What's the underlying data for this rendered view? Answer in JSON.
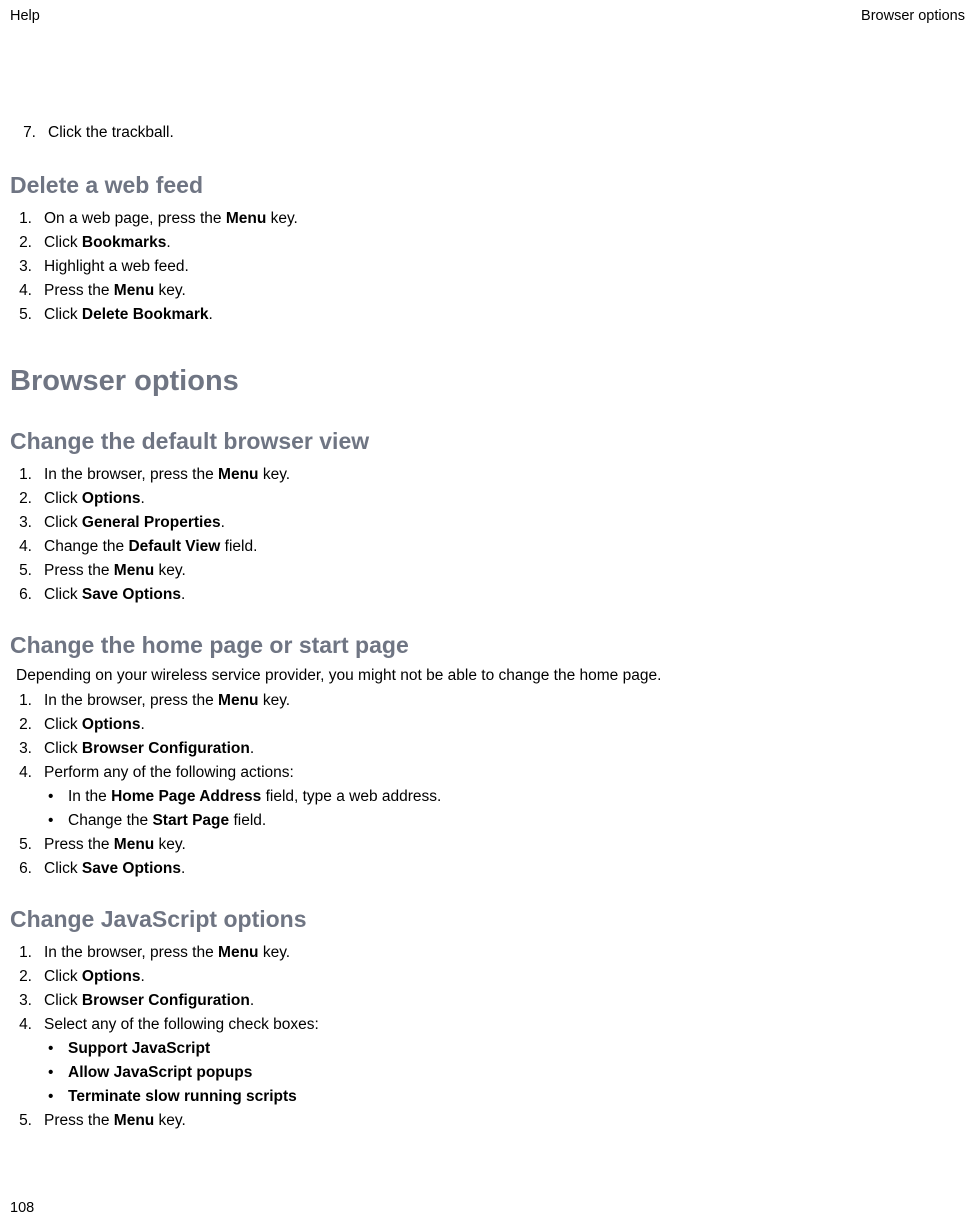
{
  "header": {
    "left": "Help",
    "right": "Browser options"
  },
  "step7": {
    "num": "7.",
    "text": "Click the trackball."
  },
  "sections": {
    "delete_feed": {
      "title": "Delete a web feed",
      "steps": [
        {
          "num": "1.",
          "pre": "On a web page, press the ",
          "bold": "Menu",
          "post": " key."
        },
        {
          "num": "2.",
          "pre": "Click ",
          "bold": "Bookmarks",
          "post": "."
        },
        {
          "num": "3.",
          "pre": "Highlight a web feed.",
          "bold": "",
          "post": ""
        },
        {
          "num": "4.",
          "pre": "Press the ",
          "bold": "Menu",
          "post": " key."
        },
        {
          "num": "5.",
          "pre": "Click ",
          "bold": "Delete Bookmark",
          "post": "."
        }
      ]
    },
    "browser_options": {
      "title": "Browser options"
    },
    "default_view": {
      "title": "Change the default browser view",
      "steps": [
        {
          "num": "1.",
          "pre": "In the browser, press the ",
          "bold": "Menu",
          "post": " key."
        },
        {
          "num": "2.",
          "pre": "Click ",
          "bold": "Options",
          "post": "."
        },
        {
          "num": "3.",
          "pre": "Click ",
          "bold": "General Properties",
          "post": "."
        },
        {
          "num": "4.",
          "pre": "Change the ",
          "bold": "Default View",
          "post": " field."
        },
        {
          "num": "5.",
          "pre": "Press the ",
          "bold": "Menu",
          "post": " key."
        },
        {
          "num": "6.",
          "pre": "Click ",
          "bold": "Save Options",
          "post": "."
        }
      ]
    },
    "home_page": {
      "title": "Change the home page or start page",
      "intro": "Depending on your wireless service provider, you might not be able to change the home page.",
      "steps": [
        {
          "num": "1.",
          "pre": "In the browser, press the ",
          "bold": "Menu",
          "post": " key."
        },
        {
          "num": "2.",
          "pre": "Click ",
          "bold": "Options",
          "post": "."
        },
        {
          "num": "3.",
          "pre": "Click ",
          "bold": "Browser Configuration",
          "post": "."
        },
        {
          "num": "4.",
          "pre": "Perform any of the following actions:",
          "bold": "",
          "post": ""
        },
        {
          "num": "5.",
          "pre": "Press the ",
          "bold": "Menu",
          "post": " key."
        },
        {
          "num": "6.",
          "pre": "Click ",
          "bold": "Save Options",
          "post": "."
        }
      ],
      "bullets": [
        {
          "pre": "In the ",
          "bold": "Home Page Address",
          "post": " field, type a web address."
        },
        {
          "pre": "Change the ",
          "bold": "Start Page",
          "post": " field."
        }
      ]
    },
    "javascript": {
      "title": "Change JavaScript options",
      "steps": [
        {
          "num": "1.",
          "pre": "In the browser, press the ",
          "bold": "Menu",
          "post": " key."
        },
        {
          "num": "2.",
          "pre": "Click ",
          "bold": "Options",
          "post": "."
        },
        {
          "num": "3.",
          "pre": "Click ",
          "bold": "Browser Configuration",
          "post": "."
        },
        {
          "num": "4.",
          "pre": "Select any of the following check boxes:",
          "bold": "",
          "post": ""
        },
        {
          "num": "5.",
          "pre": "Press the ",
          "bold": "Menu",
          "post": " key."
        }
      ],
      "bullets": [
        {
          "bold": "Support JavaScript"
        },
        {
          "bold": "Allow JavaScript popups"
        },
        {
          "bold": "Terminate slow running scripts"
        }
      ]
    }
  },
  "page_number": "108"
}
